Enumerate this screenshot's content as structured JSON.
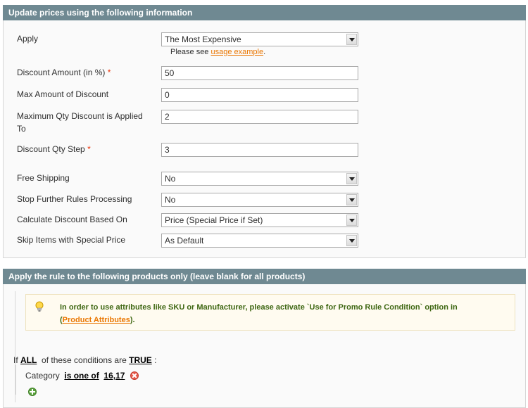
{
  "section1": {
    "title": "Update prices using the following information",
    "apply": {
      "label": "Apply",
      "value": "The Most Expensive",
      "note_prefix": "Please see",
      "note_link": "usage example",
      "note_suffix": "."
    },
    "discount_amount": {
      "label": "Discount Amount (in %)",
      "required": "*",
      "value": "50"
    },
    "max_amount": {
      "label": "Max Amount of Discount",
      "value": "0"
    },
    "max_qty": {
      "label": "Maximum Qty Discount is Applied To",
      "value": "2"
    },
    "qty_step": {
      "label": "Discount Qty Step",
      "required": "*",
      "value": "3"
    },
    "free_shipping": {
      "label": "Free Shipping",
      "value": "No"
    },
    "stop_rules": {
      "label": "Stop Further Rules Processing",
      "value": "No"
    },
    "calc_based": {
      "label": "Calculate Discount Based On",
      "value": "Price (Special Price if Set)"
    },
    "skip_special": {
      "label": "Skip Items with Special Price",
      "value": "As Default"
    }
  },
  "section2": {
    "title": "Apply the rule to the following products only (leave blank for all products)",
    "notice": {
      "text": "In order to use attributes like SKU or Manufacturer, please activate `Use for Promo Rule Condition` option in",
      "link_open": "(",
      "link": "Product Attributes",
      "link_close": ")."
    },
    "condition": {
      "prefix": "If",
      "aggregator": "ALL",
      "middle": "of these conditions are",
      "value": "TRUE",
      "suffix": ":"
    },
    "rule": {
      "attribute": "Category",
      "operator": "is one of",
      "value": "16,17"
    },
    "icons": {
      "remove": "remove-icon",
      "add": "add-icon",
      "bulb": "lightbulb-icon"
    }
  },
  "colors": {
    "header": "#6f8992",
    "required": "#eb340a",
    "link": "#ea7601",
    "notice_text": "#3d6611"
  }
}
